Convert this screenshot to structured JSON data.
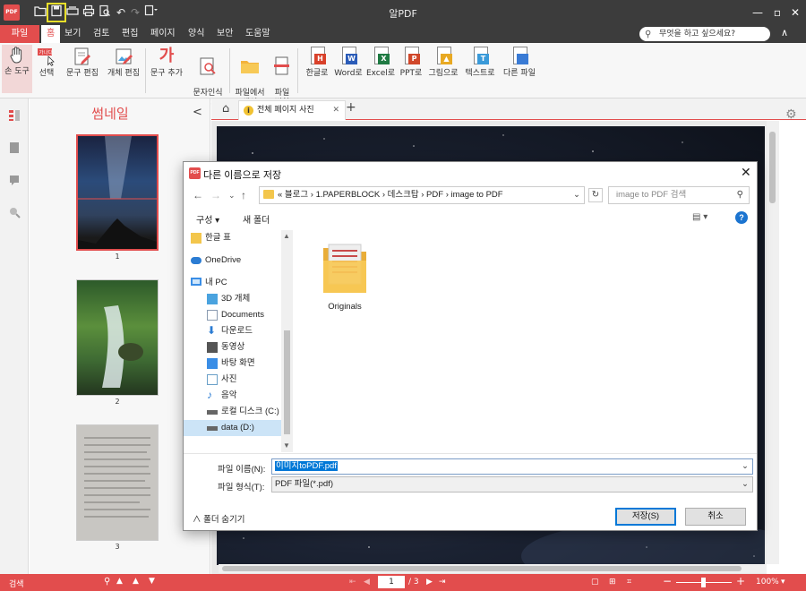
{
  "app": {
    "title": "알PDF",
    "logo_text": "PDF"
  },
  "menubar": {
    "items": [
      "파일",
      "홈",
      "보기",
      "검토",
      "편집",
      "페이지",
      "양식",
      "보안",
      "도움말"
    ],
    "search_placeholder": "무엇을 하고 싶으세요?"
  },
  "ribbon": {
    "buttons": [
      {
        "label": "손 도구",
        "icon": "hand-icon"
      },
      {
        "label": "선택",
        "icon": "select-text-icon"
      },
      {
        "label": "문구 편집",
        "icon": "edit-text-icon"
      },
      {
        "label": "개체 편집",
        "icon": "edit-object-icon"
      },
      {
        "label": "문구 추가",
        "icon": "add-text-icon",
        "glyph": "가"
      },
      {
        "label": "문자인식\n(OCR)",
        "icon": "ocr-icon"
      },
      {
        "label": "파일에서\n생성",
        "icon": "folder-icon"
      },
      {
        "label": "파일\n병합",
        "icon": "merge-icon"
      },
      {
        "label": "한글로",
        "icon": "hwp-icon",
        "badge": "H",
        "color": "#d9412b"
      },
      {
        "label": "Word로",
        "icon": "word-icon",
        "badge": "W",
        "color": "#2b5cb8"
      },
      {
        "label": "Excel로",
        "icon": "excel-icon",
        "badge": "X",
        "color": "#1f7a43"
      },
      {
        "label": "PPT로",
        "icon": "ppt-icon",
        "badge": "P",
        "color": "#d0472a"
      },
      {
        "label": "그림으로",
        "icon": "image-icon",
        "badge": "▲",
        "color": "#e8a923"
      },
      {
        "label": "텍스트로",
        "icon": "text-icon",
        "badge": "T",
        "color": "#3a9ad9"
      },
      {
        "label": "다른 파일",
        "icon": "other-file-icon",
        "badge": "",
        "color": "#3a7bd5"
      }
    ]
  },
  "thumbnails": {
    "title": "썸네일",
    "pages": [
      {
        "number": "1",
        "selected": true
      },
      {
        "number": "2",
        "selected": false
      },
      {
        "number": "3",
        "selected": false
      }
    ]
  },
  "tabs": {
    "active_label": "전체 페이지 사진"
  },
  "statusbar": {
    "left_label": "검색",
    "current_page": "1",
    "total_pages": "/ 3",
    "zoom": "100%"
  },
  "dialog": {
    "title": "다른 이름으로 저장",
    "logo_text": "PDF",
    "breadcrumb": "«  블로그  ›  1.PAPERBLOCK  ›  데스크탑  ›  PDF  ›  image to PDF",
    "search_placeholder": "image to PDF 검색",
    "toolbar": {
      "organize": "구성 ▾",
      "new_folder": "새 폴더"
    },
    "nav_items": [
      {
        "label": "한글 표",
        "icon": "folder-icon",
        "color": "#f3c64c"
      },
      {
        "label": "OneDrive",
        "icon": "cloud-icon",
        "color": "#2b7cd3"
      },
      {
        "label": "내 PC",
        "icon": "computer-icon",
        "color": "#3a8ee6"
      },
      {
        "label": "3D 개체",
        "icon": "cube-icon",
        "color": "#4aa3df"
      },
      {
        "label": "Documents",
        "icon": "documents-icon",
        "color": "#8a9bb0"
      },
      {
        "label": "다운로드",
        "icon": "download-icon",
        "color": "#2b7cd3"
      },
      {
        "label": "동영상",
        "icon": "video-icon",
        "color": "#555"
      },
      {
        "label": "바탕 화면",
        "icon": "desktop-icon",
        "color": "#3a8ee6"
      },
      {
        "label": "사진",
        "icon": "pictures-icon",
        "color": "#6aa0c8"
      },
      {
        "label": "음악",
        "icon": "music-icon",
        "color": "#2b7cd3"
      },
      {
        "label": "로컬 디스크 (C:)",
        "icon": "drive-icon",
        "color": "#666"
      },
      {
        "label": "data (D:)",
        "icon": "drive-icon",
        "color": "#666"
      }
    ],
    "folder_items": [
      {
        "label": "Originals"
      }
    ],
    "filename_label": "파일 이름(N):",
    "filename_value": "이미지toPDF.pdf",
    "filetype_label": "파일 형식(T):",
    "filetype_value": "PDF 파일(*.pdf)",
    "hide_folders": "∧  폴더 숨기기",
    "save_button": "저장(S)",
    "cancel_button": "취소"
  }
}
